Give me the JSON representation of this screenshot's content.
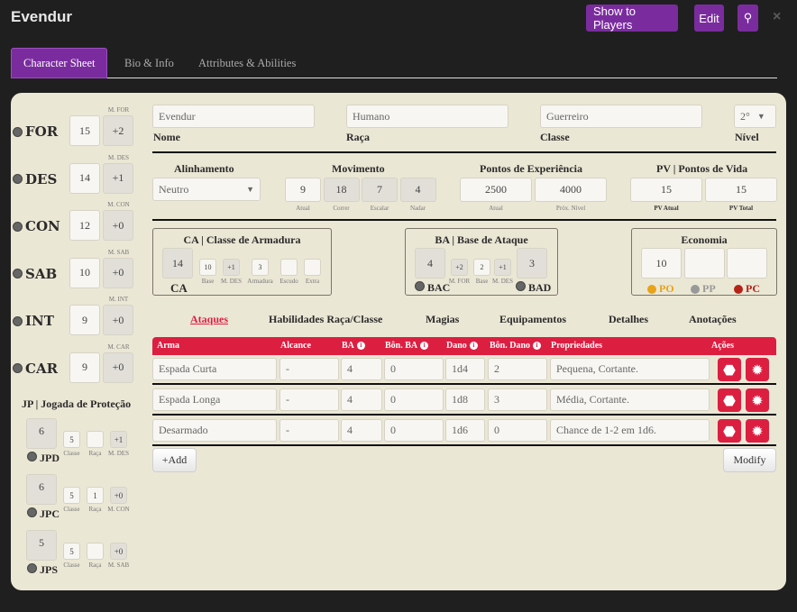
{
  "window": {
    "title": "Evendur",
    "show_to_players": "Show to Players",
    "edit": "Edit",
    "close": "×"
  },
  "tabs": [
    {
      "label": "Character Sheet"
    },
    {
      "label": "Bio & Info"
    },
    {
      "label": "Attributes & Abilities"
    }
  ],
  "attributes": [
    {
      "name": "FOR",
      "value": "15",
      "mod_label": "M. FOR",
      "mod": "+2"
    },
    {
      "name": "DES",
      "value": "14",
      "mod_label": "M. DES",
      "mod": "+1"
    },
    {
      "name": "CON",
      "value": "12",
      "mod_label": "M. CON",
      "mod": "+0"
    },
    {
      "name": "SAB",
      "value": "10",
      "mod_label": "M. SAB",
      "mod": "+0"
    },
    {
      "name": "INT",
      "value": "9",
      "mod_label": "M. INT",
      "mod": "+0"
    },
    {
      "name": "CAR",
      "value": "9",
      "mod_label": "M. CAR",
      "mod": "+0"
    }
  ],
  "saves": {
    "title": "JP | Jogada de Proteção",
    "items": [
      {
        "name": "JPD",
        "total": "6",
        "classe": "5",
        "raca": "",
        "mod": "+1",
        "mod_label": "M. DES"
      },
      {
        "name": "JPC",
        "total": "6",
        "classe": "5",
        "raca": "1",
        "mod": "+0",
        "mod_label": "M. CON"
      },
      {
        "name": "JPS",
        "total": "5",
        "classe": "5",
        "raca": "",
        "mod": "+0",
        "mod_label": "M. SAB"
      }
    ],
    "classe_label": "Classe",
    "raca_label": "Raça"
  },
  "identity": {
    "nome": {
      "value": "Evendur",
      "label": "Nome"
    },
    "raca": {
      "value": "Humano",
      "label": "Raça"
    },
    "classe": {
      "value": "Guerreiro",
      "label": "Classe"
    },
    "nivel": {
      "value": "2°",
      "label": "Nível"
    }
  },
  "alinhamento": {
    "label": "Alinhamento",
    "value": "Neutro"
  },
  "movimento": {
    "label": "Movimento",
    "items": [
      {
        "value": "9",
        "label": "Atual"
      },
      {
        "value": "18",
        "label": "Correr"
      },
      {
        "value": "7",
        "label": "Escalar"
      },
      {
        "value": "4",
        "label": "Nadar"
      }
    ]
  },
  "xp": {
    "label": "Pontos de Experiência",
    "atual": "2500",
    "atual_label": "Atual",
    "prox": "4000",
    "prox_label": "Próx. Nível"
  },
  "pv": {
    "label": "PV | Pontos de Vida",
    "atual": "15",
    "atual_label": "PV Atual",
    "total": "15",
    "total_label": "PV Total"
  },
  "ca": {
    "title": "CA | Classe de Armadura",
    "total": "14",
    "label": "CA",
    "parts": [
      {
        "value": "10",
        "label": "Base"
      },
      {
        "value": "+1",
        "label": "M. DES"
      },
      {
        "value": "3",
        "label": "Armadura"
      },
      {
        "value": "",
        "label": "Escudo"
      },
      {
        "value": "",
        "label": "Extra"
      }
    ]
  },
  "ba": {
    "title": "BA | Base de Ataque",
    "bac": "4",
    "bac_label": "BAC",
    "bad": "3",
    "bad_label": "BAD",
    "parts": [
      {
        "value": "+2",
        "label": "M. FOR"
      },
      {
        "value": "2",
        "label": "Base"
      },
      {
        "value": "+1",
        "label": "M. DES"
      }
    ]
  },
  "economia": {
    "title": "Economia",
    "po": "10",
    "pp": "",
    "pc": "",
    "po_label": "PO",
    "pp_label": "PP",
    "pc_label": "PC",
    "colors": {
      "po": "#e8a317",
      "pp": "#999999",
      "pc": "#b4231a"
    }
  },
  "section_tabs": [
    "Ataques",
    "Habilidades Raça/Classe",
    "Magias",
    "Equipamentos",
    "Detalhes",
    "Anotações"
  ],
  "attacks": {
    "headers": [
      "Arma",
      "Alcance",
      "BA",
      "Bôn. BA",
      "Dano",
      "Bôn. Dano",
      "Propriedades",
      "Ações"
    ],
    "rows": [
      {
        "arma": "Espada Curta",
        "alcance": "-",
        "ba": "4",
        "bon_ba": "0",
        "dano": "1d4",
        "bon_dano": "2",
        "prop": "Pequena, Cortante."
      },
      {
        "arma": "Espada Longa",
        "alcance": "-",
        "ba": "4",
        "bon_ba": "0",
        "dano": "1d8",
        "bon_dano": "3",
        "prop": "Média, Cortante."
      },
      {
        "arma": "Desarmado",
        "alcance": "-",
        "ba": "4",
        "bon_ba": "0",
        "dano": "1d6",
        "bon_dano": "0",
        "prop": "Chance de 1-2 em 1d6."
      }
    ],
    "add": "+Add",
    "modify": "Modify"
  }
}
